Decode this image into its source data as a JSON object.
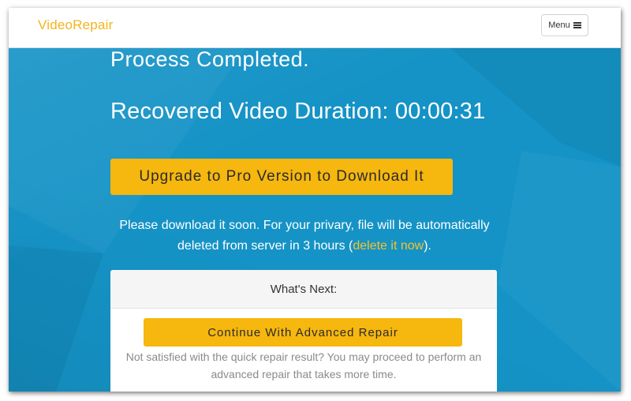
{
  "navbar": {
    "brand": "VideoRepair",
    "menu_label": "Menu",
    "menu_icon": "hamburger-icon"
  },
  "hero": {
    "status": "Process Completed.",
    "duration_text": "Recovered Video Duration: 00:00:31",
    "upgrade_label": "Upgrade to Pro Version to Download It",
    "notice_before": "Please download it soon. For your privary, file will be automatically deleted from server in 3 hours (",
    "notice_link": "delete it now",
    "notice_after": ")."
  },
  "next_panel": {
    "title": "What's Next:",
    "advanced_label": "Continue With Advanced Repair",
    "description": "Not satisfied with the quick repair result? You may proceed to perform an advanced repair that takes more time."
  },
  "colors": {
    "brand": "#f4b41a",
    "hero_background": "#1593c6",
    "button": "#f6b70e",
    "link": "#f6c32a"
  }
}
